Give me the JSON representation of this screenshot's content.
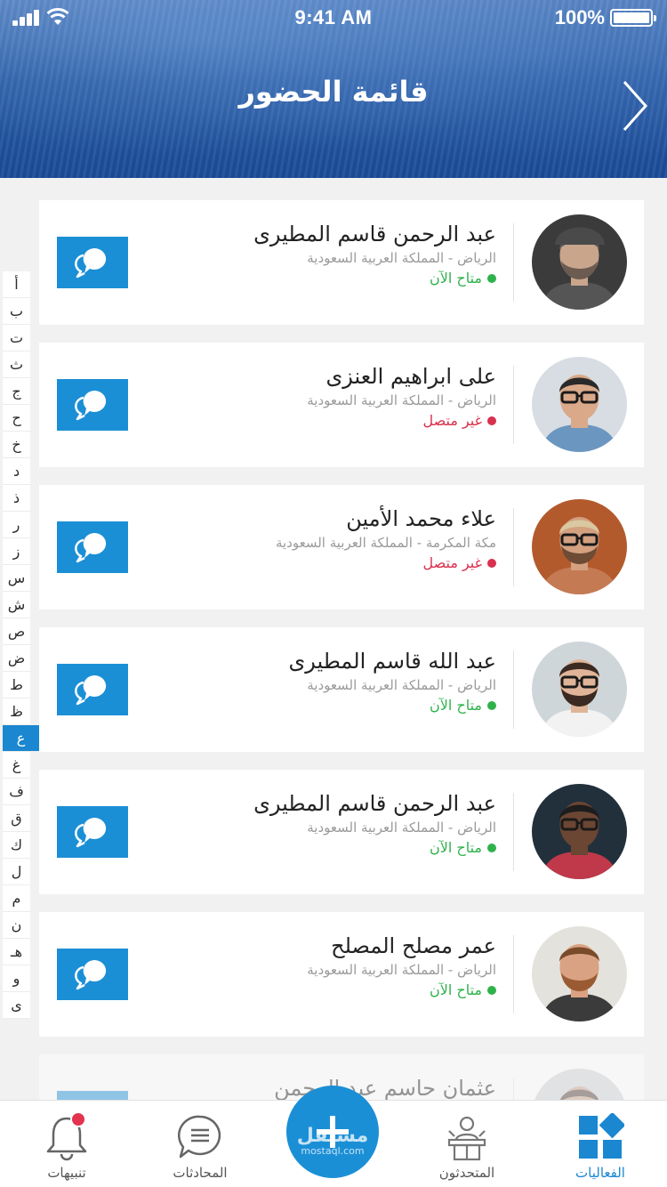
{
  "status_bar": {
    "time": "9:41 AM",
    "battery": "100%"
  },
  "header": {
    "title": "قائمة الحضور",
    "back_icon": "chevron-right-icon"
  },
  "alphabet": [
    "أ",
    "ب",
    "ت",
    "ث",
    "ج",
    "ح",
    "خ",
    "د",
    "ذ",
    "ر",
    "ز",
    "س",
    "ش",
    "ص",
    "ض",
    "ط",
    "ظ",
    "ع",
    "غ",
    "ف",
    "ق",
    "ك",
    "ل",
    "م",
    "ن",
    "هـ",
    "و",
    "ى"
  ],
  "alphabet_active": "ع",
  "colors": {
    "accent": "#1b8fd6",
    "online": "#2fb24c",
    "offline": "#d9304d"
  },
  "attendees": [
    {
      "name": "عبد الرحمن قاسم المطيرى",
      "location": "الرياض - المملكة العربية السعودية",
      "status": "متاح الآن",
      "online": true
    },
    {
      "name": "على ابراهيم العنزى",
      "location": "الرياض - المملكة العربية السعودية",
      "status": "غير متصل",
      "online": false
    },
    {
      "name": "علاء محمد الأمين",
      "location": "مكة المكرمة - المملكة العربية السعودية",
      "status": "غير متصل",
      "online": false
    },
    {
      "name": "عبد الله قاسم المطيرى",
      "location": "الرياض - المملكة العربية السعودية",
      "status": "متاح الآن",
      "online": true
    },
    {
      "name": "عبد الرحمن قاسم المطيرى",
      "location": "الرياض - المملكة العربية السعودية",
      "status": "متاح الآن",
      "online": true
    },
    {
      "name": "عمر مصلح المصلح",
      "location": "الرياض - المملكة العربية السعودية",
      "status": "متاح الآن",
      "online": true
    },
    {
      "name": "عثمان حاسم عبد الرحمن",
      "location": "",
      "status": "",
      "online": true
    }
  ],
  "tabbar": {
    "tabs": [
      {
        "label": "تنبيهات",
        "icon": "bell-icon"
      },
      {
        "label": "المحادثات",
        "icon": "chat-bubble-icon"
      },
      {
        "label": "",
        "icon": "plus-icon"
      },
      {
        "label": "المتحدثون",
        "icon": "speaker-icon"
      },
      {
        "label": "الفعاليات",
        "icon": "events-icon"
      }
    ],
    "active": "الفعاليات"
  },
  "watermark": {
    "text": "مستقل",
    "url": "mostaql.com"
  }
}
